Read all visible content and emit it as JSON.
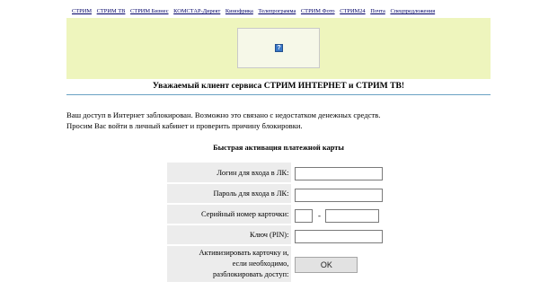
{
  "nav": {
    "links": [
      "СТРИМ",
      "СТРИМ ТВ",
      "СТРИМ Бизнес",
      "КОМСТАР-Директ",
      "Кинофрика",
      "Телепрограмма",
      "СТРИМ Фото",
      "СТРИМ24",
      "Почта",
      "Спецпредложения"
    ]
  },
  "banner": {
    "icon": "broken-image-icon",
    "glyph": "?"
  },
  "greeting": "Уважаемый клиент сервиса СТРИМ ИНТЕРНЕТ и СТРИМ ТВ!",
  "message": {
    "line1": "Ваш доступ в Интернет заблокирован. Возможно это связано с недостатком денежных средств.",
    "line2": "Просим Вас войти в личный кабинет и проверить причину блокировки."
  },
  "form": {
    "title": "Быстрая активация платежной карты",
    "login_label": "Логин для входа в ЛК:",
    "login_value": "",
    "password_label": "Пароль для входа в ЛК:",
    "password_value": "",
    "serial_label": "Серийный номер карточки:",
    "serial_part1": "",
    "serial_sep": "-",
    "serial_part2": "",
    "pin_label": "Ключ (PIN):",
    "pin_value": "",
    "activate_label_1": "Активизировать карточку и,",
    "activate_label_2": "если необходимо,",
    "activate_label_3": "разблокировать доступ:",
    "ok_label": "OK"
  }
}
